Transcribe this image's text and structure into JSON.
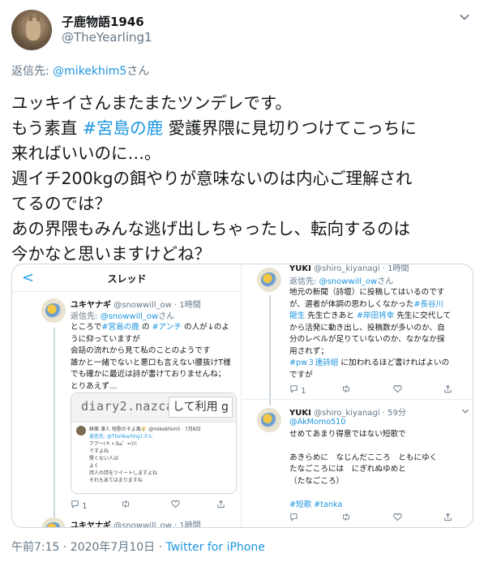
{
  "author": {
    "display_name": "子鹿物語1946",
    "handle": "@TheYearling1"
  },
  "reply": {
    "prefix": "返信先: ",
    "mention": "@mikekhim5",
    "suffix": "さん"
  },
  "tweet": {
    "line1": "ユッキイさんまたまたツンデレです。",
    "line2_a": "もう素直 ",
    "line2_tag": "#宮島の鹿",
    "line2_b": " 愛護界隈に見切りつけてこっちに",
    "line3": "来ればいいのに…。",
    "line4": "週イチ200kgの餌やりが意味ないのは内心ご理解され",
    "line5": "てるのでは？",
    "line6": "あの界隈もみんな逃げ出しちゃったし、転向するのは",
    "line7": "今かなと思いますけどね？"
  },
  "left_shot": {
    "back": "<",
    "title": "スレッド",
    "name": "ユキヤナギ",
    "handle_time": " @snowwill_ow · 1時間",
    "reply_prefix": "返信先: ",
    "reply_mention": "@snowwill_ow",
    "reply_suffix": "さん",
    "l1_a": "ところで",
    "l1_tag1": "#宮島の鹿",
    "l1_b": " の ",
    "l1_tag2": "#アンチ",
    "l1_c": " の人が↓のよ",
    "l2": "うに仰っていますが",
    "l3": "会話の流れから見て私のことのようです",
    "l4": "誰かと一緒でないと悪口も言えない腰抜けT様",
    "l5": "でも確かに最近は詩が書けておりませんね；",
    "l6": "とりあえず…",
    "banner_text1": "diary2.nazca.c",
    "banner_text2": "して利用 g",
    "nested": {
      "n1": "鉢面 凛人 短歌のそよ風🌾 @mikekhim5 · 7月8日",
      "n2": "返信先: @TheYearling1さん",
      "n3": "アアー(＊ゝ3ω゜=)!!",
      "n4": "ですよね",
      "n5": "賢くない人は",
      "n6": "よく",
      "n7": "詩人の詩をツイートしますよね",
      "n8": "それもあてはまりますね"
    },
    "actions": [
      "1",
      "",
      ""
    ],
    "next_name": "ユキヤナギ",
    "next_handle": " @snowwill_ow · 1時間"
  },
  "right_shot": {
    "name1": "YUKI",
    "handle1": " @shiro_kiyanagi · 1時間",
    "reply_prefix": "返信先: ",
    "reply_mention": "@snowwill_ow",
    "reply_suffix": "さん",
    "b1": "地元の新聞（詩壇）に投稿してはいるのです",
    "b2_a": "が、選者が体調の思わしくなかった",
    "b2_tag": "#長谷川",
    "b3_tag": "龍生",
    "b3_b": " 先生亡きあと ",
    "b3_tag2": "#岸田将幸",
    "b3_c": " 先生に交代して",
    "b4": "から活発に動き出し、投稿数が多いのか、自",
    "b5": "分のレベルが足りていないのか、なかなか採",
    "b6": "用されず；",
    "b7_tag": "#pw３連詩組",
    "b7_b": " に加われるほど書ければよいの",
    "b8": "ですが",
    "actions1": [
      "1",
      "",
      ""
    ],
    "name2": "YUKI",
    "handle2": " @shiro_kiyanagi · 59分",
    "c0": "@AkMomo510",
    "c1": "せめてあまり得意ではない短歌で",
    "c2": "",
    "c3": "あきらめに　なじんだこころ　ともにゆく",
    "c4": "たなごころには　にぎれぬゆめと",
    "c5": "（たなごころ）",
    "c6": "",
    "c7_tag1": "#短歌",
    "c7_sep": " ",
    "c7_tag2": "#tanka",
    "actions2": [
      "",
      "",
      ""
    ]
  },
  "meta": {
    "time": "午前7:15 · 2020年7月10日 · ",
    "source": "Twitter for iPhone"
  }
}
